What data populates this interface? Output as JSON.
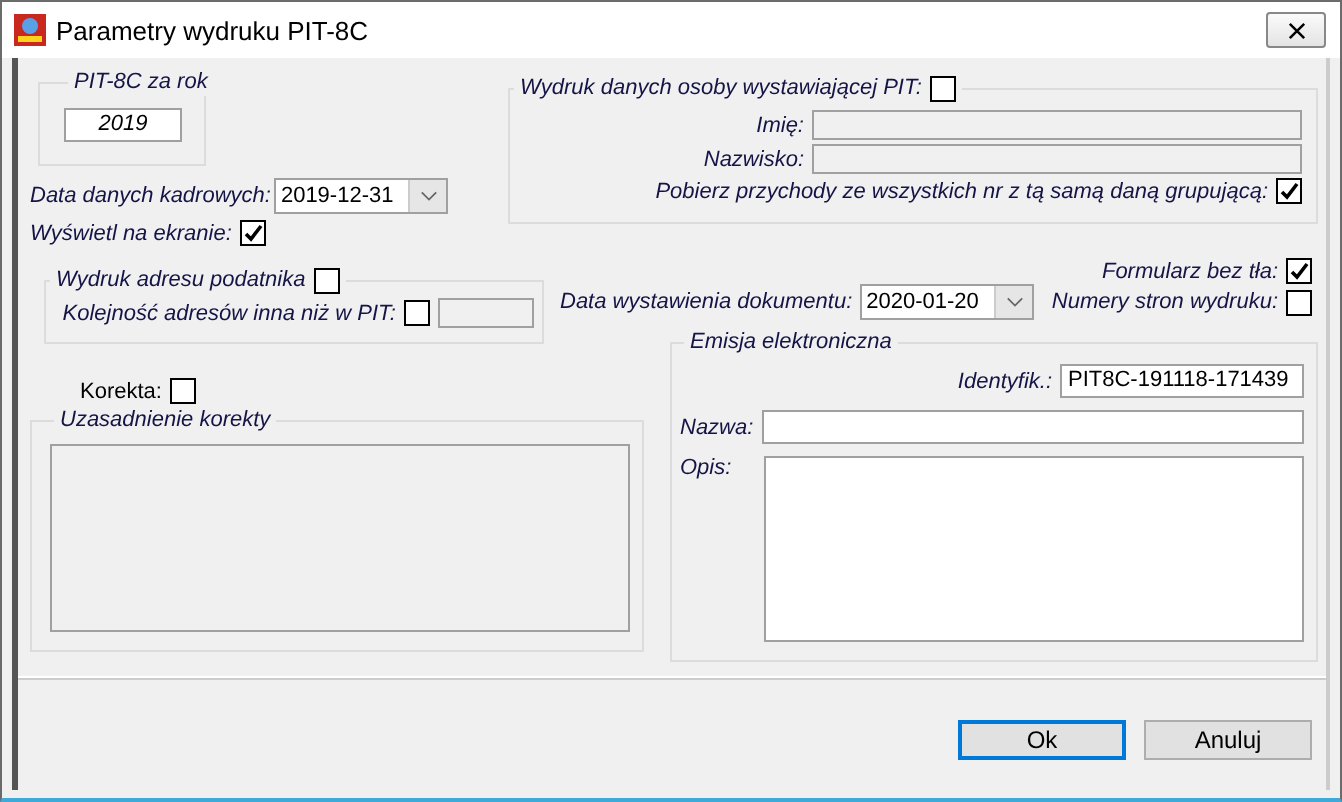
{
  "window": {
    "title": "Parametry wydruku PIT-8C"
  },
  "year_group": {
    "label": "PIT-8C za rok",
    "value": "2019"
  },
  "hr_date": {
    "label": "Data danych kadrowych:",
    "value": "2019-12-31"
  },
  "show_on_screen": {
    "label": "Wyświetl na ekranie:",
    "checked": true
  },
  "issuer_group": {
    "label": "Wydruk danych osoby wystawiającej PIT:",
    "checked": false,
    "fields_disabled": true,
    "first_name_label": "Imię:",
    "last_name_label": "Nazwisko:",
    "fetch_income": {
      "label": "Pobierz przychody ze wszystkich nr z tą samą daną grupującą:",
      "checked": true
    }
  },
  "address_group": {
    "label": "Wydruk adresu podatnika",
    "checked": false,
    "order_label": "Kolejność adresów inna niż w PIT:",
    "order_checked": false,
    "order_field_disabled": true
  },
  "no_background": {
    "label": "Formularz bez tła:",
    "checked": true
  },
  "issue_date": {
    "label": "Data wystawienia dokumentu:",
    "value": "2020-01-20"
  },
  "page_numbers": {
    "label": "Numery stron wydruku:",
    "checked": false
  },
  "correction": {
    "label": "Korekta:",
    "checked": false
  },
  "correction_reason": {
    "label": "Uzasadnienie korekty",
    "disabled": true
  },
  "e_emission": {
    "label": "Emisja elektroniczna",
    "id_label": "Identyfik.:",
    "id_value": "PIT8C-191118-171439",
    "name_label": "Nazwa:",
    "description_label": "Opis:"
  },
  "buttons": [
    {
      "label": "Ok",
      "default": true
    },
    {
      "label": "Anuluj",
      "default": false
    }
  ]
}
